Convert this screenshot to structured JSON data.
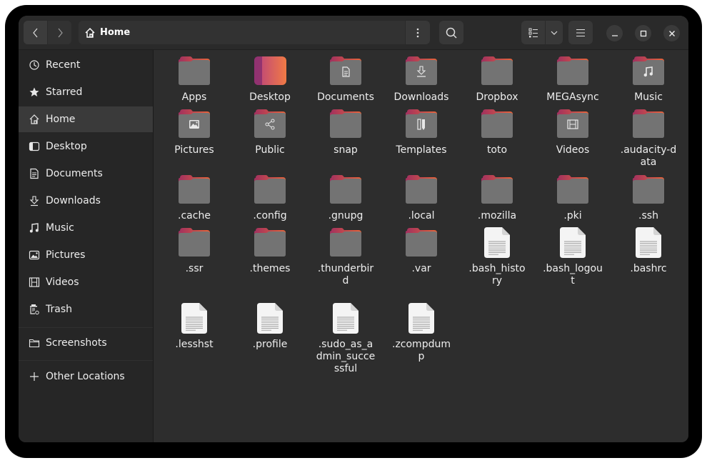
{
  "window": {
    "path_label": "Home",
    "nav": {
      "back": "back",
      "forward": "forward"
    },
    "header_buttons": [
      "path-menu",
      "search",
      "view-list",
      "view-options",
      "main-menu"
    ],
    "window_controls": [
      "minimize",
      "maximize",
      "close"
    ]
  },
  "sidebar": {
    "items": [
      {
        "label": "Recent",
        "icon": "clock-icon"
      },
      {
        "label": "Starred",
        "icon": "star-icon"
      },
      {
        "label": "Home",
        "icon": "home-icon",
        "active": true
      },
      {
        "label": "Desktop",
        "icon": "desktop-icon"
      },
      {
        "label": "Documents",
        "icon": "document-icon"
      },
      {
        "label": "Downloads",
        "icon": "download-icon"
      },
      {
        "label": "Music",
        "icon": "music-icon"
      },
      {
        "label": "Pictures",
        "icon": "picture-icon"
      },
      {
        "label": "Videos",
        "icon": "video-icon"
      },
      {
        "label": "Trash",
        "icon": "trash-icon"
      }
    ],
    "bookmarks": [
      {
        "label": "Screenshots",
        "icon": "folder-icon"
      }
    ],
    "other": {
      "label": "Other Locations",
      "icon": "plus-icon"
    }
  },
  "files": [
    {
      "name": "Apps",
      "type": "folder",
      "emblem": ""
    },
    {
      "name": "Desktop",
      "type": "desktop",
      "emblem": ""
    },
    {
      "name": "Documents",
      "type": "folder",
      "emblem": "document"
    },
    {
      "name": "Downloads",
      "type": "folder",
      "emblem": "download"
    },
    {
      "name": "Dropbox",
      "type": "folder",
      "emblem": ""
    },
    {
      "name": "MEGAsync",
      "type": "folder",
      "emblem": ""
    },
    {
      "name": "Music",
      "type": "folder",
      "emblem": "music"
    },
    {
      "name": "Pictures",
      "type": "folder",
      "emblem": "picture"
    },
    {
      "name": "Public",
      "type": "folder",
      "emblem": "share"
    },
    {
      "name": "snap",
      "type": "folder",
      "emblem": ""
    },
    {
      "name": "Templates",
      "type": "folder",
      "emblem": "template"
    },
    {
      "name": "toto",
      "type": "folder",
      "emblem": ""
    },
    {
      "name": "Videos",
      "type": "folder",
      "emblem": "video"
    },
    {
      "name": ".audacity-data",
      "type": "folder",
      "emblem": ""
    },
    {
      "name": ".cache",
      "type": "folder",
      "emblem": ""
    },
    {
      "name": ".config",
      "type": "folder",
      "emblem": ""
    },
    {
      "name": ".gnupg",
      "type": "folder",
      "emblem": ""
    },
    {
      "name": ".local",
      "type": "folder",
      "emblem": ""
    },
    {
      "name": ".mozilla",
      "type": "folder",
      "emblem": ""
    },
    {
      "name": ".pki",
      "type": "folder",
      "emblem": ""
    },
    {
      "name": ".ssh",
      "type": "folder",
      "emblem": ""
    },
    {
      "name": ".ssr",
      "type": "folder",
      "emblem": ""
    },
    {
      "name": ".themes",
      "type": "folder",
      "emblem": ""
    },
    {
      "name": ".thunderbird",
      "type": "folder",
      "emblem": ""
    },
    {
      "name": ".var",
      "type": "folder",
      "emblem": ""
    },
    {
      "name": ".bash_history",
      "type": "file",
      "emblem": ""
    },
    {
      "name": ".bash_logout",
      "type": "file",
      "emblem": ""
    },
    {
      "name": ".bashrc",
      "type": "file",
      "emblem": ""
    },
    {
      "name": ".lesshst",
      "type": "file",
      "emblem": ""
    },
    {
      "name": ".profile",
      "type": "file",
      "emblem": ""
    },
    {
      "name": ".sudo_as_admin_successful",
      "type": "file",
      "emblem": ""
    },
    {
      "name": ".zcompdump",
      "type": "file",
      "emblem": ""
    }
  ],
  "colors": {
    "folder_tab_start": "#a0305f",
    "folder_tab_end": "#e9643a",
    "folder_body": "#737373",
    "accent": "#e95420"
  }
}
